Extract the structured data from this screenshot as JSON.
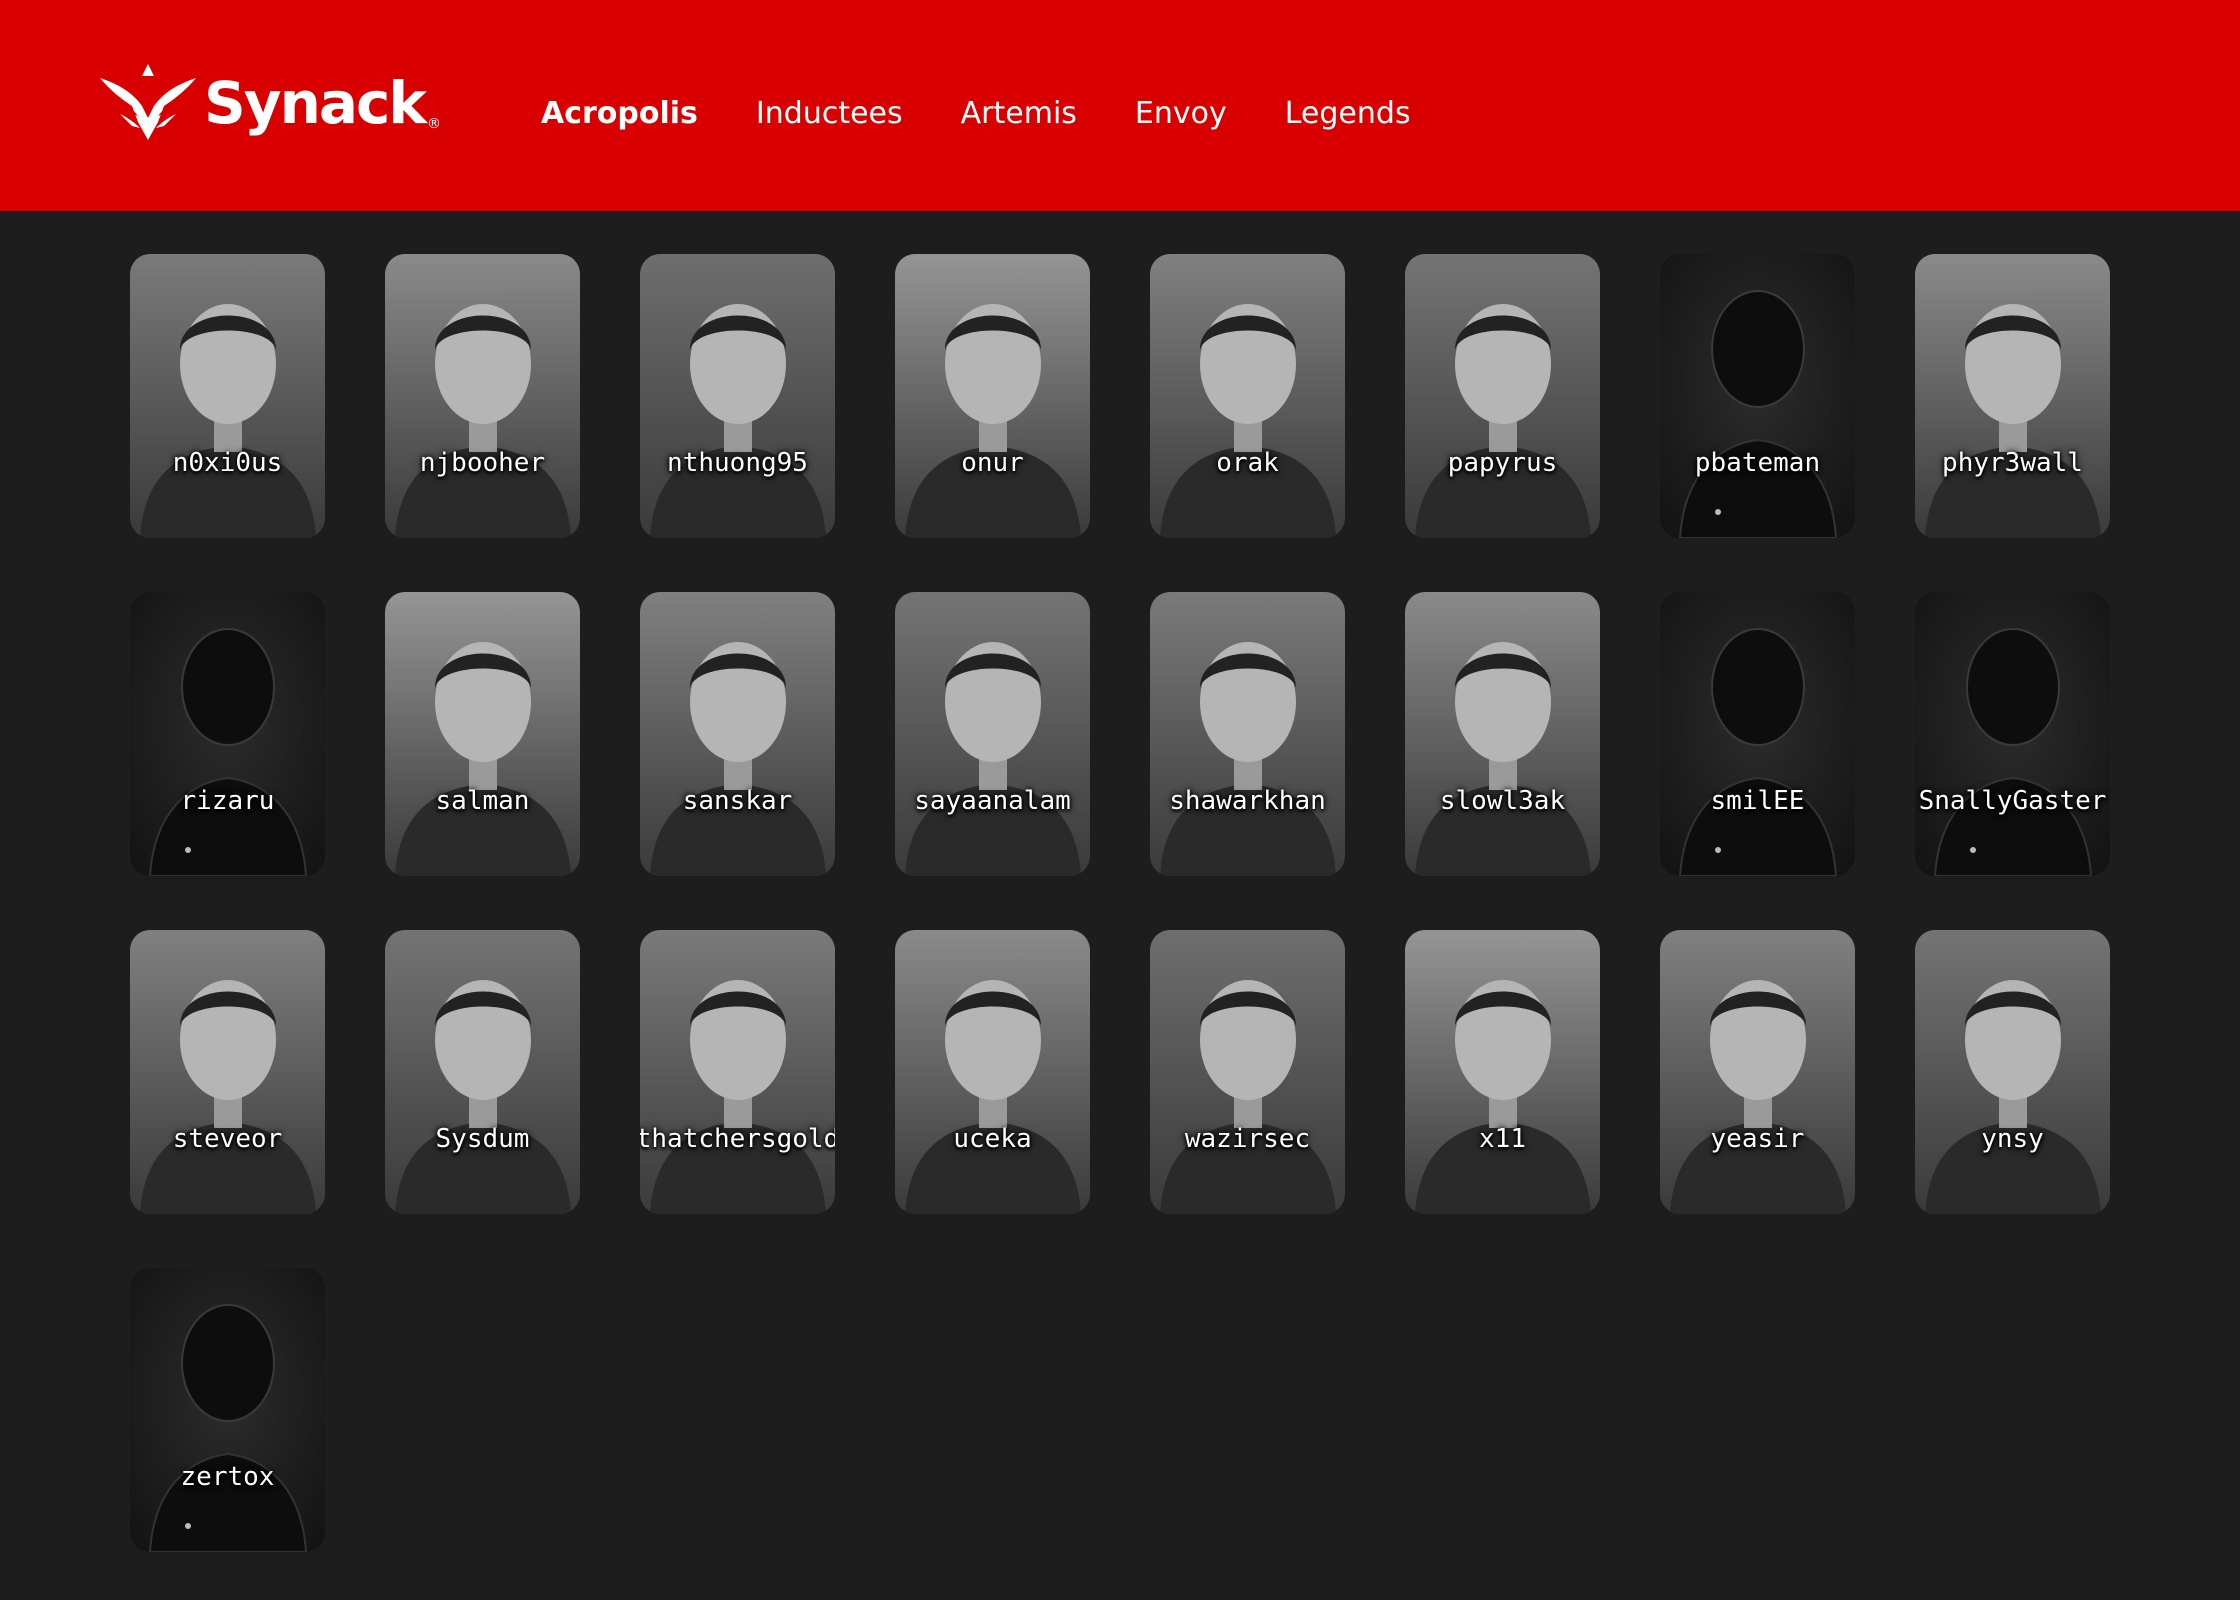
{
  "brand": {
    "name": "Synack",
    "registered": "®",
    "logo_icon": "winged-shield-icon",
    "color": "#d80000",
    "background": "#1d1d1d"
  },
  "nav": {
    "items": [
      {
        "label": "Acropolis",
        "active": true
      },
      {
        "label": "Inductees",
        "active": false
      },
      {
        "label": "Artemis",
        "active": false
      },
      {
        "label": "Envoy",
        "active": false
      },
      {
        "label": "Legends",
        "active": false
      }
    ]
  },
  "members": [
    {
      "handle": "n0xi0us",
      "photo": "portrait-photo"
    },
    {
      "handle": "njbooher",
      "photo": "portrait-photo"
    },
    {
      "handle": "nthuong95",
      "photo": "portrait-photo"
    },
    {
      "handle": "onur",
      "photo": "portrait-photo"
    },
    {
      "handle": "orak",
      "photo": "portrait-photo"
    },
    {
      "handle": "papyrus",
      "photo": "portrait-photo"
    },
    {
      "handle": "pbateman",
      "photo": "silhouette-placeholder"
    },
    {
      "handle": "phyr3wall",
      "photo": "portrait-photo"
    },
    {
      "handle": "rizaru",
      "photo": "silhouette-placeholder"
    },
    {
      "handle": "salman",
      "photo": "portrait-photo"
    },
    {
      "handle": "sanskar",
      "photo": "portrait-photo"
    },
    {
      "handle": "sayaanalam",
      "photo": "portrait-photo"
    },
    {
      "handle": "shawarkhan",
      "photo": "portrait-photo"
    },
    {
      "handle": "slowl3ak",
      "photo": "portrait-photo"
    },
    {
      "handle": "smilEE",
      "photo": "silhouette-placeholder"
    },
    {
      "handle": "SnallyGaster",
      "photo": "silhouette-placeholder"
    },
    {
      "handle": "steveor",
      "photo": "avatar-character"
    },
    {
      "handle": "Sysdum",
      "photo": "portrait-photo"
    },
    {
      "handle": "thatchersgold",
      "photo": "portrait-photo"
    },
    {
      "handle": "uceka",
      "photo": "portrait-photo"
    },
    {
      "handle": "wazirsec",
      "photo": "portrait-photo"
    },
    {
      "handle": "x11",
      "photo": "portrait-photo"
    },
    {
      "handle": "yeasir",
      "photo": "portrait-photo"
    },
    {
      "handle": "ynsy",
      "photo": "portrait-photo"
    },
    {
      "handle": "zertox",
      "photo": "silhouette-placeholder"
    }
  ]
}
